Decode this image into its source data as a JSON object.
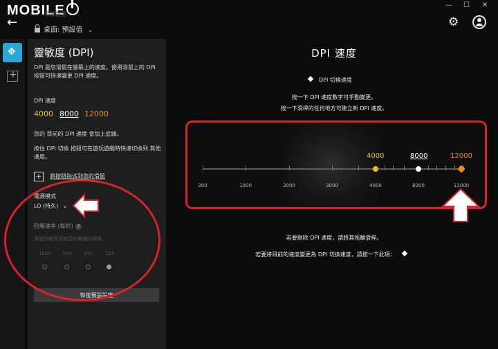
{
  "header": {
    "logo": "MOBILE",
    "device_subtitle": "滑鼠裝置",
    "profile_label": "桌面: 預設值",
    "window_controls": [
      "—",
      "☐",
      "✕"
    ]
  },
  "panel": {
    "title": "靈敏度 (DPI)",
    "description": "DPI 是您滑鼠在螢幕上的速度。使用滑鼠上的 DPI 按鈕可快速變更 DPI 速度。",
    "dpi_speed_label": "DPI 速度",
    "stages": [
      {
        "value": "4000",
        "color": "#f2c200"
      },
      {
        "value": "8000",
        "color": "#ffffff",
        "selected": true
      },
      {
        "value": "12000",
        "color": "#f08a1e"
      }
    ],
    "current_note": "您的 目前的 DPI 速度 會加上底線。",
    "switch_note": "按住 DPI 切換 按鈕可在遊玩遊戲時快速切換到 其他速度。",
    "assign_link": "將按鈕指派到您的滑鼠",
    "power_mode_label": "電源模式",
    "power_mode_value": "LO (持久)",
    "polling_label": "回報速率 (每秒)",
    "polling_help": "?",
    "polling_desc": "滑鼠回報資訊給您的電腦的頻率。",
    "rates": [
      {
        "value": "1000",
        "selected": false
      },
      {
        "value": "500",
        "selected": false
      },
      {
        "value": "250",
        "selected": false
      },
      {
        "value": "125",
        "selected": true
      }
    ],
    "reset_button": "恢復預設設定"
  },
  "main": {
    "title": "DPI 速度",
    "legend": "DPI 切換速度",
    "instruction_1": "按一下 DPI 速度數字可手動變更。",
    "instruction_2": "按一下滑桿的任何地方可建立新 DPI 速度。",
    "footer_1": "若要刪除 DPI 速度，請將其拖離滑桿。",
    "footer_2": "若要將目前的速度變更為 DPI 切換速度，請按一下此項：",
    "scale_labels": [
      "200",
      "1000",
      "2000",
      "3000",
      "4000",
      "8000",
      "12000"
    ]
  },
  "colors": {
    "accent": "#2aa8d8",
    "annotation": "#d8232a",
    "stage_1": "#f2c200",
    "stage_3": "#f08a1e"
  }
}
